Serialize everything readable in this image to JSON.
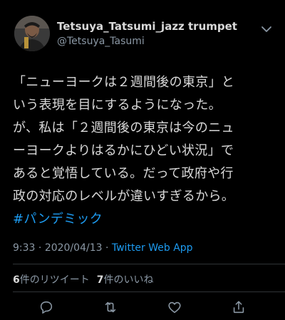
{
  "author": {
    "display_name": "Tetsuya_Tatsumi_jazz trumpet",
    "handle": "@Tetsuya_Tasumi"
  },
  "tweet": {
    "lines": [
      "「ニューヨークは２週間後の東京」と",
      "いう表現を目にするようになった。",
      "が、私は「２週間後の東京は今のニュ",
      "ーヨークよりはるかにひどい状況」で",
      "あると覚悟している。だって政府や行",
      "政の対応のレベルが違いすぎるから。"
    ],
    "hashtag": "#パンデミック"
  },
  "meta": {
    "time": "9:33",
    "separator": " · ",
    "date": "2020/04/13",
    "source": "Twitter Web App"
  },
  "stats": {
    "retweets_count": "6",
    "retweets_label": "件のリツイート",
    "likes_count": "7",
    "likes_label": "件のいいね"
  },
  "colors": {
    "background": "#000000",
    "text": "#d9d9d9",
    "secondary": "#8b98a5",
    "link": "#1d9bf0"
  },
  "icons": [
    "chevron-down-icon",
    "reply-icon",
    "retweet-icon",
    "like-icon",
    "share-icon"
  ]
}
